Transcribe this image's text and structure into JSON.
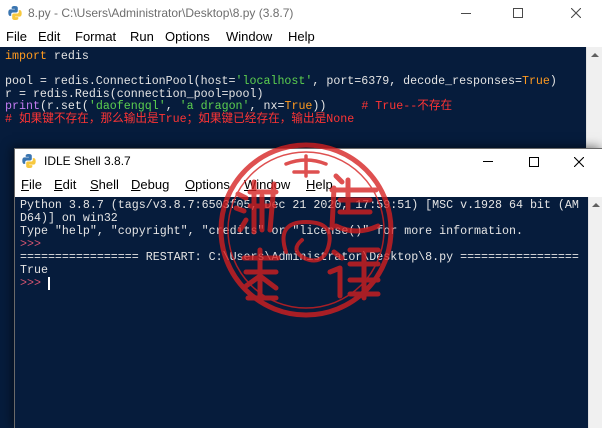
{
  "editor": {
    "title": "8.py - C:\\Users\\Administrator\\Desktop\\8.py (3.8.7)",
    "menu": [
      "File",
      "Edit",
      "Format",
      "Run",
      "Options",
      "Window",
      "Help"
    ],
    "code_lines": [
      [
        "import",
        " redis"
      ],
      [],
      [
        "pool = redis.ConnectionPool(host=",
        "'localhost'",
        ", port=6379, decode_responses=",
        "True",
        ")"
      ],
      [
        "r = redis.Redis(connection_pool=pool)"
      ],
      [
        "print",
        "(r.set(",
        "'daofengql'",
        ", ",
        "'a dragon'",
        ", nx=",
        "True",
        "))     ",
        "# True--不存在"
      ],
      [
        "# 如果键不存在，那么输出是True；如果键已经存在，输出是None"
      ]
    ]
  },
  "shell": {
    "title": "IDLE Shell 3.8.7",
    "menu": [
      "File",
      "Edit",
      "Shell",
      "Debug",
      "Options",
      "Window",
      "Help"
    ],
    "banner": [
      "Python 3.8.7 (tags/v3.8.7:6503f05, Dec 21 2020, 17:59:51) [MSC v.1928 64 bit (AM",
      "D64)] on win32",
      "Type \"help\", \"copyright\", \"credits\" or \"license()\" for more information."
    ],
    "prompt": ">>> ",
    "restart_line": "================= RESTART: C:\\Users\\Administrator\\Desktop\\8.py =================",
    "output": "True"
  },
  "icons": {
    "app": "python-icon",
    "window_controls": [
      "minimize-icon",
      "maximize-icon",
      "close-icon"
    ],
    "scrollbar": "scroll-up-arrow-icon",
    "overlay": "red-seal-watermark"
  },
  "theme": {
    "background": "#061c3c",
    "text": "#e4e4e4",
    "keyword": "#ff9a1f",
    "builtin": "#c27bf0",
    "string": "#5ccf4f",
    "comment": "#ff3434",
    "prompt": "#d65470",
    "cursor": "#ffffff",
    "seal": "#d61f1f"
  }
}
